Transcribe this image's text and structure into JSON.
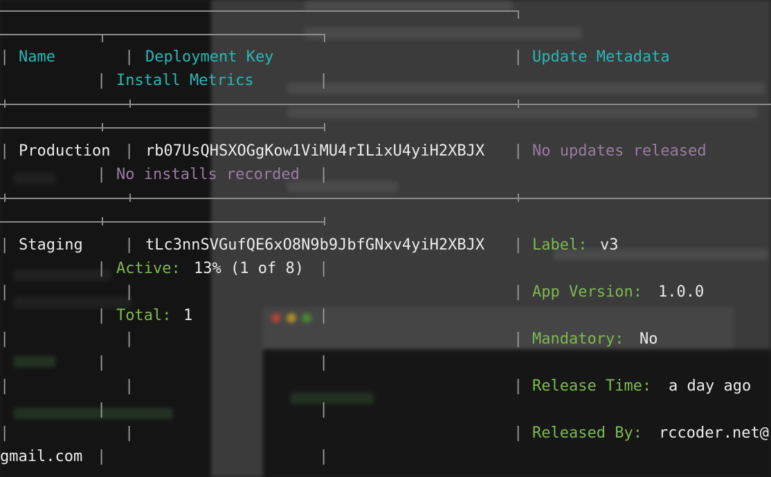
{
  "table": {
    "headers": {
      "name": "Name",
      "deployment_key": "Deployment Key",
      "update_metadata": "Update Metadata",
      "install_metrics": "Install Metrics"
    },
    "rows": [
      {
        "name": "Production",
        "key": "rb07UsQHSXOGgKow1ViMU4rILixU4yiH2XBJX",
        "update_metadata": "No updates released",
        "install_metrics": "No installs recorded"
      },
      {
        "name": "Staging",
        "key": "tLc3nnSVGufQE6xO8N9b9JbfGNxv4yiH2XBJX",
        "metadata": {
          "label_key": "Label:",
          "label_val": "v3",
          "app_version_key": "App Version:",
          "app_version_val": "1.0.0",
          "mandatory_key": "Mandatory:",
          "mandatory_val": "No",
          "release_time_key": "Release Time:",
          "release_time_val": "a day ago",
          "released_by_key": "Released By:",
          "released_by_val": "rccoder.net@",
          "released_by_wrap": "gmail.com"
        },
        "metrics": {
          "active_key": "Active:",
          "active_val": "13% (1 of 8)",
          "total_key": "Total:",
          "total_val": "1"
        }
      }
    ]
  },
  "colors": {
    "header": "#2ab7b7",
    "meta_key": "#7cba4e",
    "empty_state": "#9a7ba3",
    "text": "#ececec",
    "border": "#8c8c8c"
  }
}
